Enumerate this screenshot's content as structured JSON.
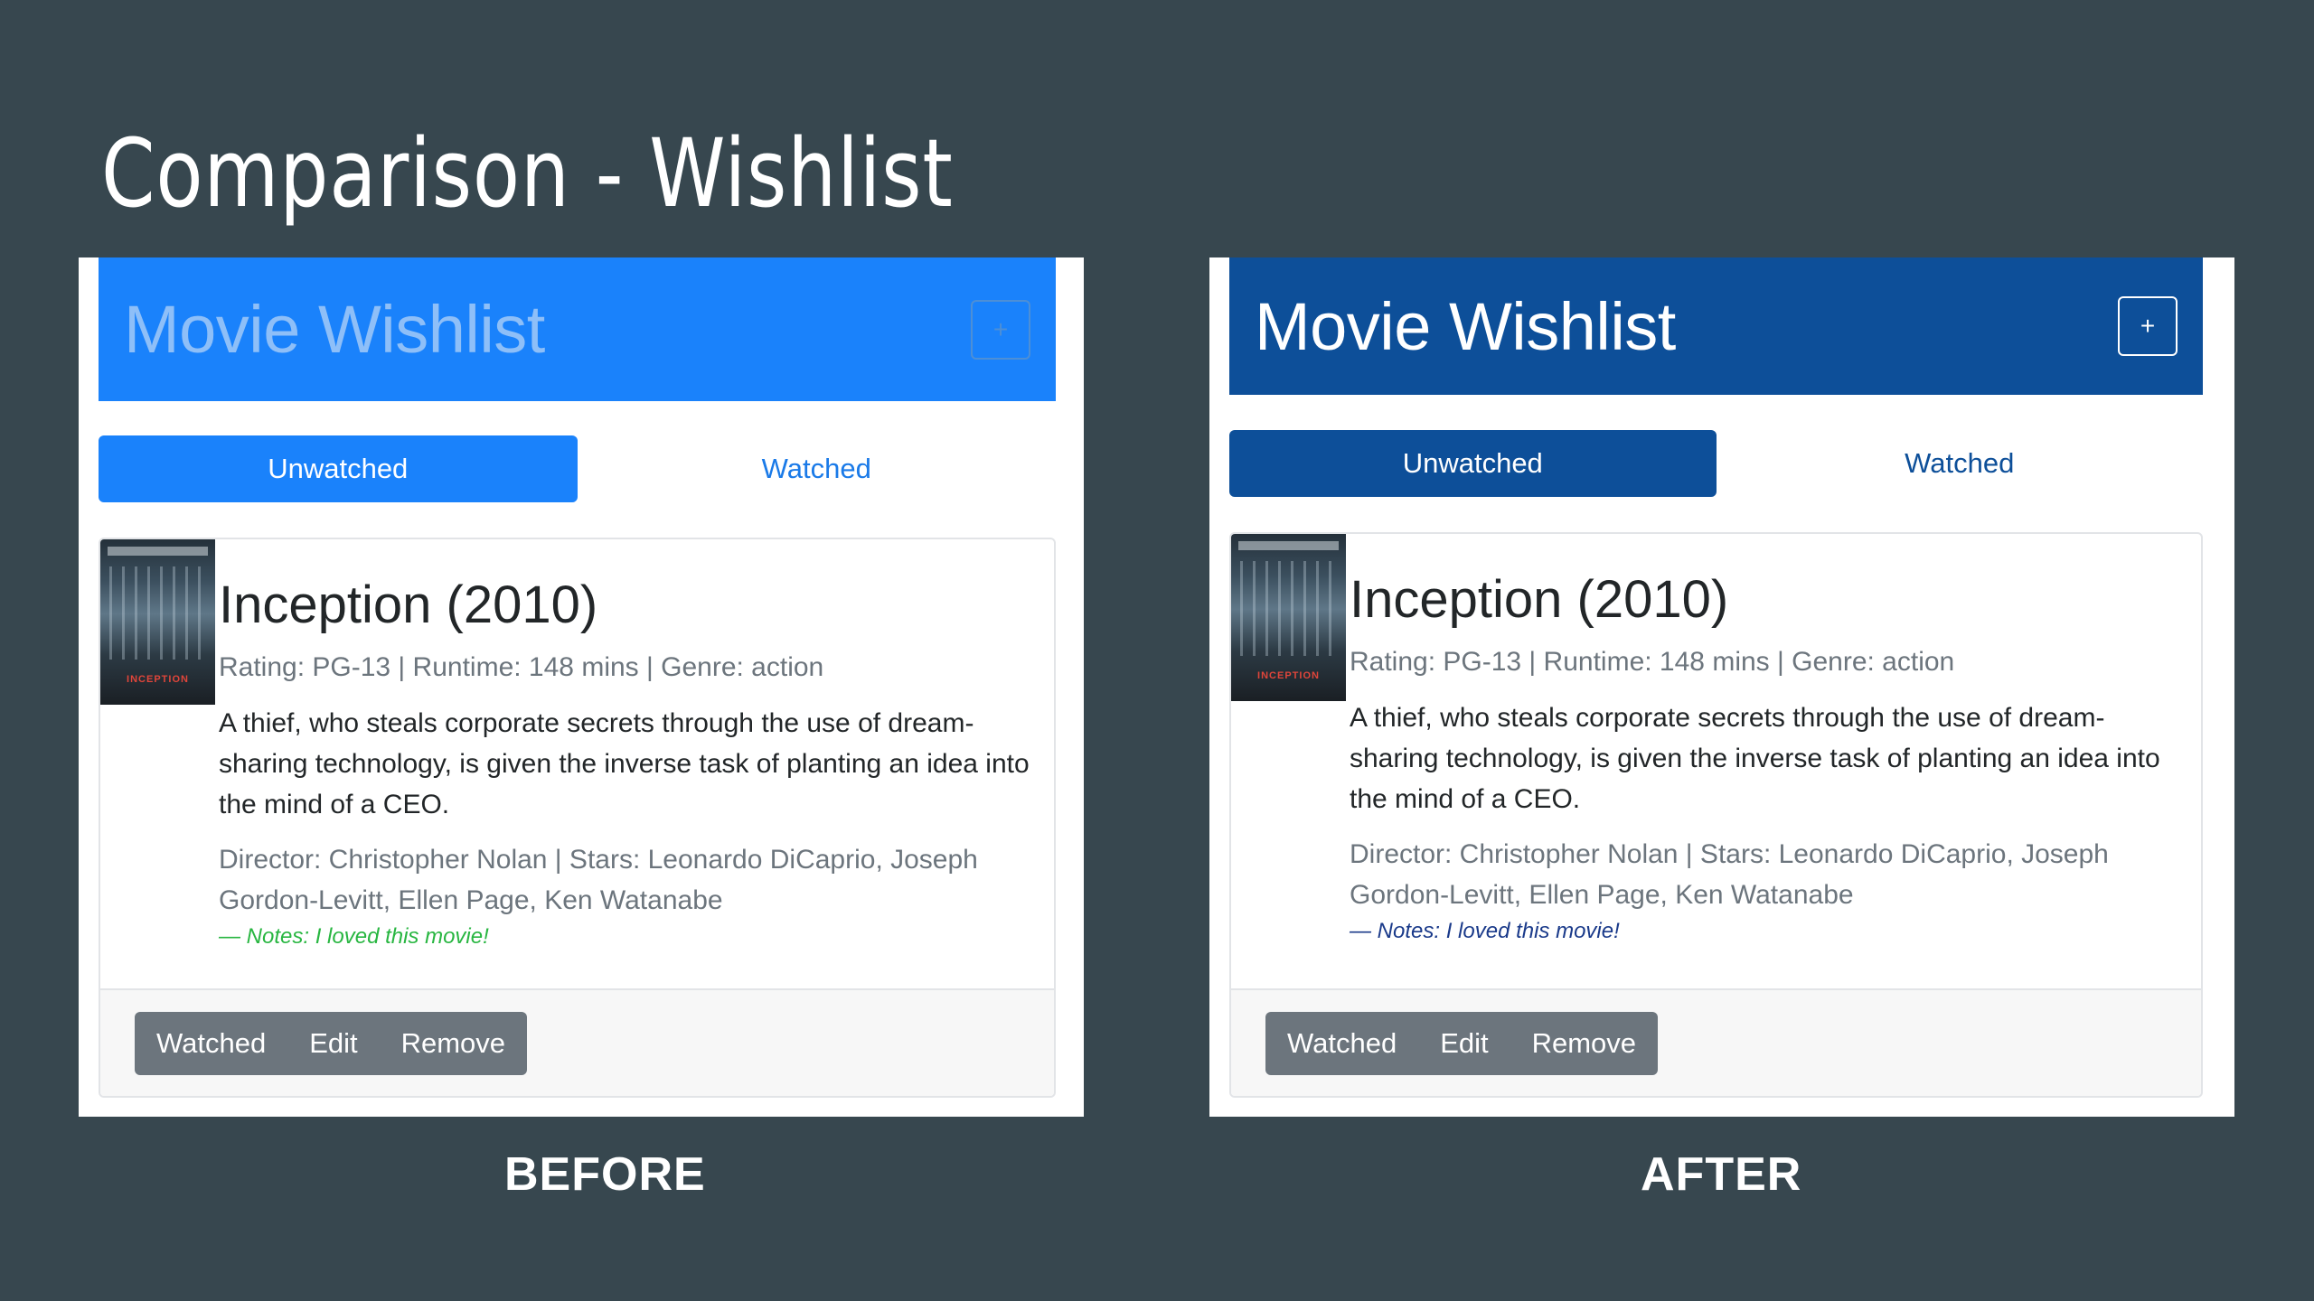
{
  "slide": {
    "title": "Comparison - Wishlist",
    "before_caption": "BEFORE",
    "after_caption": "AFTER"
  },
  "app": {
    "header_title": "Movie Wishlist",
    "add_button": "+",
    "tabs": [
      {
        "label": "Unwatched",
        "active": true
      },
      {
        "label": "Watched",
        "active": false
      }
    ],
    "movie": {
      "title": "Inception (2010)",
      "meta": "Rating: PG-13 | Runtime: 148 mins | Genre: action",
      "synopsis": "A thief, who steals corporate secrets through the use of dream-sharing technology, is given the inverse task of planting an idea into the mind of a CEO.",
      "credits": "Director: Christopher Nolan | Stars: Leonardo DiCaprio, Joseph Gordon-Levitt, Ellen Page, Ken Watanabe",
      "notes": "— Notes: I loved this movie!",
      "poster_label": "INCEPTION"
    },
    "actions": [
      "Watched",
      "Edit",
      "Remove"
    ]
  },
  "colors": {
    "slide_background": "#37474f",
    "before_primary": "#1a82fb",
    "after_primary": "#0d4f99",
    "before_notes": "#28b641",
    "after_notes": "#1a3a8a",
    "button_group": "#6c757d"
  },
  "icons": {
    "add": "plus-icon",
    "poster": "movie-poster-image"
  }
}
